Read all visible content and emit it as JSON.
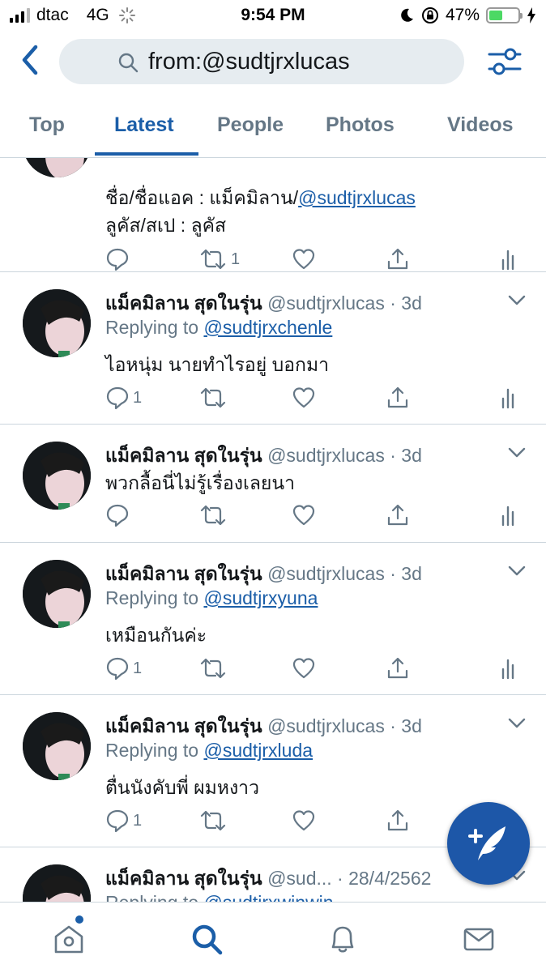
{
  "status_bar": {
    "carrier": "dtac",
    "network": "4G",
    "time": "9:54 PM",
    "battery_percent": "47%",
    "battery_level": 0.47
  },
  "search": {
    "query": "from:@sudtjrxlucas"
  },
  "tabs": [
    {
      "label": "Top"
    },
    {
      "label": "Latest",
      "active": true
    },
    {
      "label": "People"
    },
    {
      "label": "Photos"
    },
    {
      "label": "Videos"
    }
  ],
  "tweets": [
    {
      "lines": [
        {
          "prefix": "ชื่อ/ชื่อแอค : แม็คมิลาน/",
          "link": "@sudtjrxlucas"
        },
        {
          "prefix": "ลูคัส/สเป : ลูคัส"
        }
      ],
      "reply_count": "",
      "retweet_count": "1"
    },
    {
      "name": "แม็คมิลาน สุดในรุ่น",
      "meta": "@sudtjrxlucas · 3d",
      "reply_prefix": "Replying to ",
      "reply_to": "@sudtjrxchenle",
      "text": "ไอหนุ่ม นายทำไรอยู่ บอกมา",
      "reply_count": "1",
      "retweet_count": ""
    },
    {
      "name": "แม็คมิลาน สุดในรุ่น",
      "meta": "@sudtjrxlucas · 3d",
      "text": "พวกลื้อนี่ไม่รู้เรื่องเลยนา",
      "reply_count": "",
      "retweet_count": ""
    },
    {
      "name": "แม็คมิลาน สุดในรุ่น",
      "meta": "@sudtjrxlucas · 3d",
      "reply_prefix": "Replying to ",
      "reply_to": "@sudtjrxyuna",
      "text": "เหมือนกันค่ะ",
      "reply_count": "1",
      "retweet_count": ""
    },
    {
      "name": "แม็คมิลาน สุดในรุ่น",
      "meta": "@sudtjrxlucas · 3d",
      "reply_prefix": "Replying to ",
      "reply_to": "@sudtjrxluda",
      "text": "ตื่นนังคับพี่ ผมหงาว",
      "reply_count": "1",
      "retweet_count": ""
    },
    {
      "name": "แม็คมิลาน สุดในรุ่น",
      "meta": "@sud... · 28/4/2562",
      "reply_prefix": "Replying to ",
      "reply_to": "@sudtjrxwinwin"
    }
  ],
  "colors": {
    "accent": "#1b5ea8",
    "fab": "#1d57a8",
    "muted": "#657786",
    "divider": "#ccd6dd",
    "search_bg": "#e6ecf0"
  },
  "icons": {
    "back": "chevron-left-icon",
    "search": "search-icon",
    "filter": "filter-sliders-icon",
    "reply": "reply-icon",
    "retweet": "retweet-icon",
    "like": "heart-icon",
    "share": "share-icon",
    "analytics": "analytics-icon",
    "compose": "compose-tweet-icon",
    "home": "home-icon",
    "explore": "search-icon",
    "notifications": "bell-icon",
    "messages": "mail-icon"
  }
}
